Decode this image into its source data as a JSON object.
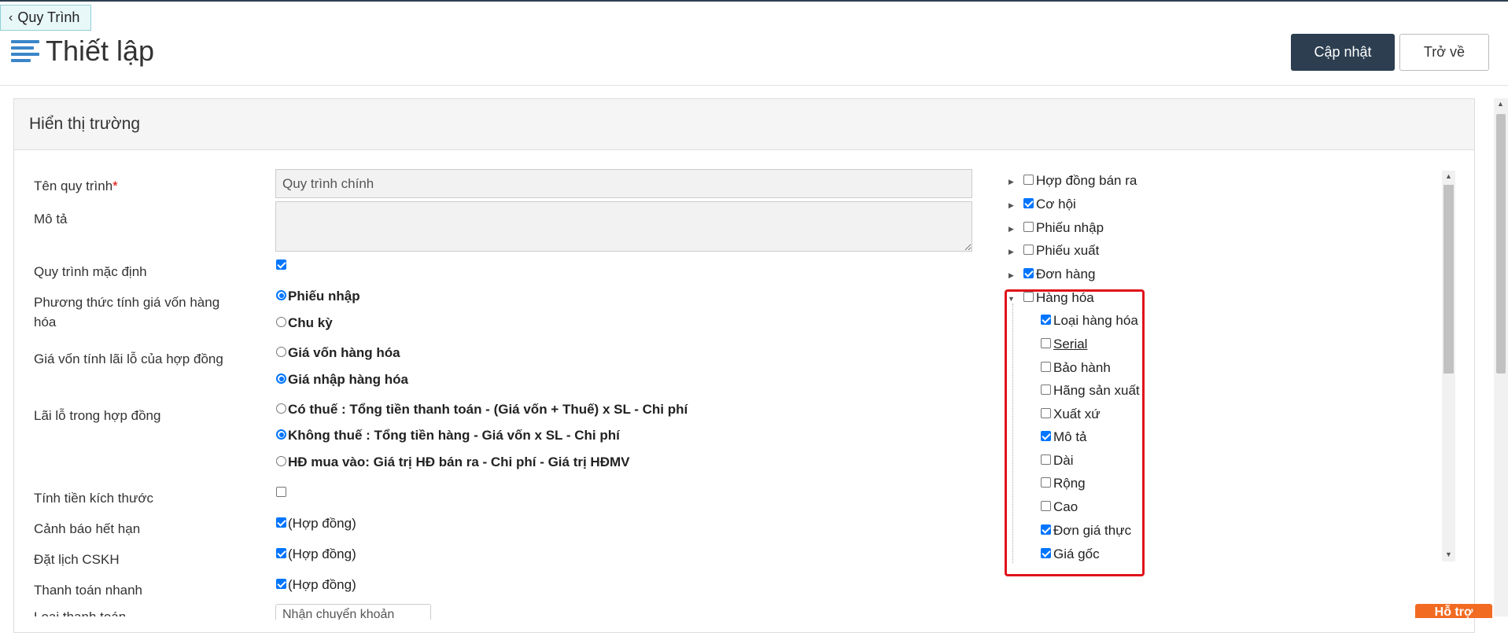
{
  "header": {
    "back_tab": "Quy Trình",
    "title": "Thiết lập",
    "update_button": "Cập nhật",
    "back_button": "Trở về"
  },
  "panel": {
    "title": "Hiển thị trường"
  },
  "form": {
    "name_label": "Tên quy trình",
    "required_mark": "*",
    "name_value": "Quy trình chính",
    "desc_label": "Mô tả",
    "default_label": "Quy trình mặc định",
    "default_checked": true,
    "cost_method_label": "Phương thức tính giá vốn hàng hóa",
    "cost_method_options": [
      {
        "label": "Phiếu nhập",
        "checked": true
      },
      {
        "label": "Chu kỳ",
        "checked": false
      }
    ],
    "profit_cost_label": "Giá vốn tính lãi lỗ của hợp đồng",
    "profit_cost_options": [
      {
        "label": "Giá vốn hàng hóa",
        "checked": false
      },
      {
        "label": "Giá nhập hàng hóa",
        "checked": true
      }
    ],
    "contract_profit_label": "Lãi lỗ trong hợp đồng",
    "contract_profit_options": [
      {
        "label": "Có thuế : Tổng tiền thanh toán - (Giá vốn + Thuế) x SL - Chi phí",
        "checked": false
      },
      {
        "label": "Không thuế : Tổng tiền hàng - Giá vốn x SL - Chi phí",
        "checked": true
      },
      {
        "label": "HĐ mua vào: Giá trị HĐ bán ra - Chi phí - Giá trị HĐMV",
        "checked": false
      }
    ],
    "size_price_label": "Tính tiền kích thước",
    "size_price_checked": false,
    "expiry_label": "Cảnh báo hết hạn",
    "expiry_text": "(Hợp đồng)",
    "expiry_checked": true,
    "care_label": "Đặt lịch CSKH",
    "care_text": "(Hợp đồng)",
    "care_checked": true,
    "quickpay_label": "Thanh toán nhanh",
    "quickpay_text": "(Hợp đồng)",
    "quickpay_checked": true,
    "paytype_label": "Loại thanh toán",
    "paytype_value": "Nhận chuyển khoản"
  },
  "tree": {
    "top_items": [
      {
        "label": "Hợp đồng bán ra",
        "checked": false
      },
      {
        "label": "Cơ hội",
        "checked": true
      },
      {
        "label": "Phiếu nhập",
        "checked": false
      },
      {
        "label": "Phiếu xuất",
        "checked": false
      },
      {
        "label": "Đơn hàng",
        "checked": true
      },
      {
        "label": "Hàng hóa",
        "checked": false
      }
    ],
    "children": [
      {
        "label": "Loại hàng hóa",
        "checked": true
      },
      {
        "label": "Serial",
        "checked": false
      },
      {
        "label": "Bảo hành",
        "checked": false
      },
      {
        "label": "Hãng sản xuất",
        "checked": false
      },
      {
        "label": "Xuất xứ",
        "checked": false
      },
      {
        "label": "Mô tả",
        "checked": true
      },
      {
        "label": "Dài",
        "checked": false
      },
      {
        "label": "Rộng",
        "checked": false
      },
      {
        "label": "Cao",
        "checked": false
      },
      {
        "label": "Đơn giá thực",
        "checked": true
      },
      {
        "label": "Giá gốc",
        "checked": true
      }
    ]
  },
  "help": {
    "label": "Hỗ trợ"
  },
  "colors": {
    "primary_dark": "#2c3e50",
    "highlight_red": "#e0121b",
    "help_orange": "#f26b22",
    "check_blue": "#0075ff"
  }
}
